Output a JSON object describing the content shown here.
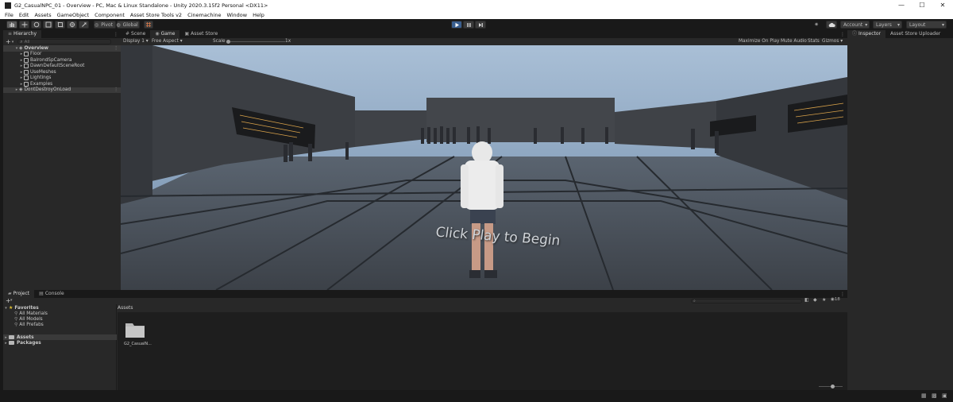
{
  "window": {
    "title": "G2_CasualNPC_01 - Overview - PC, Mac & Linux Standalone - Unity 2020.3.15f2 Personal <DX11>",
    "minimize_glyph": "—",
    "maximize_glyph": "☐",
    "close_glyph": "✕"
  },
  "menu": [
    "File",
    "Edit",
    "Assets",
    "GameObject",
    "Component",
    "Asset Store Tools v2",
    "Cinemachine",
    "Window",
    "Help"
  ],
  "toolbar": {
    "pivot_label": "Pivot",
    "global_label": "Global",
    "account_label": "Account",
    "layers_label": "Layers",
    "layout_label": "Layout",
    "dropdown_glyph": "▾"
  },
  "hierarchy": {
    "tab_label": "Hierarchy",
    "add_glyph": "+",
    "add_dropdown_glyph": "▾",
    "search_glyph": "⌕",
    "all_label": "All",
    "expand_glyph": "▾",
    "collapsed_glyph": "▸",
    "menu_glyph": "⋮",
    "root_label": "Overview",
    "items": [
      "Floor",
      "BalrondSpCamera",
      "DawnDefaultSceneRoot",
      "UseMeshes",
      "Lightings",
      "Examples"
    ],
    "second_root": "DontDestroyOnLoad"
  },
  "game_view": {
    "tabs": [
      "Scene",
      "Game",
      "Asset Store"
    ],
    "display_label": "Display 1",
    "aspect_label": "Free Aspect",
    "scale_label": "Scale",
    "scale_value": "1x",
    "maximize_label": "Maximize On Play",
    "mute_label": "Mute Audio",
    "stats_label": "Stats",
    "gizmos_label": "Gizmos",
    "scene_text": "Click Play to Begin",
    "tab_menu_glyph": "⋮"
  },
  "inspector": {
    "tabs": [
      "Inspector",
      "Asset Store Uploader"
    ]
  },
  "project": {
    "tabs": [
      "Project",
      "Console"
    ],
    "favorites_label": "Favorites",
    "favorites": [
      "All Materials",
      "All Models",
      "All Prefabs"
    ],
    "assets_label": "Assets",
    "packages_label": "Packages",
    "breadcrumb": "Assets",
    "folder_label": "G2_CasualN...",
    "hidden_count": "18",
    "add_glyph": "+",
    "add_dropdown_glyph": "▾",
    "expand_glyph": "▾",
    "collapsed_glyph": "▸",
    "star_glyph": "★",
    "search_item_glyph": "⚲"
  },
  "colors": {
    "play_active": "#3a5f8f",
    "panel_bg": "#282828",
    "toolbar_bg": "#191919"
  }
}
